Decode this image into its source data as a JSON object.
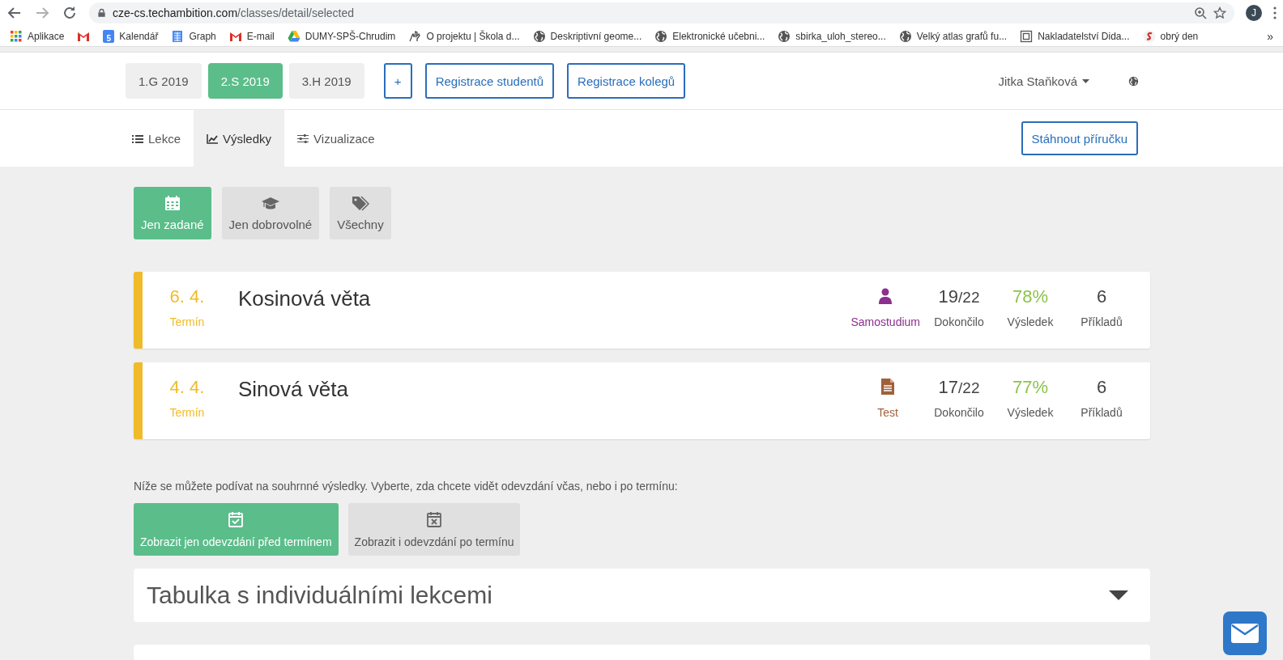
{
  "browser": {
    "url": "cze-cs.techambition.com/classes/detail/selected",
    "avatar": "J",
    "overflow": "»",
    "bookmarks": [
      {
        "kind": "apps",
        "label": "Aplikace"
      },
      {
        "kind": "gmail"
      },
      {
        "kind": "calendar",
        "label": "Kalendář",
        "icon_text": "5"
      },
      {
        "kind": "sheet",
        "label": "Graph"
      },
      {
        "kind": "gmail",
        "label": "E-mail"
      },
      {
        "kind": "drive",
        "label": "DUMY-SPŠ-Chrudim"
      },
      {
        "kind": "hand",
        "label": "O projektu | Škola d..."
      },
      {
        "kind": "globe",
        "label": "Deskriptivní geome..."
      },
      {
        "kind": "globe",
        "label": "Elektronické učebni..."
      },
      {
        "kind": "globe",
        "label": "sbirka_uloh_stereo..."
      },
      {
        "kind": "globe",
        "label": "Velký atlas grafů fu..."
      },
      {
        "kind": "page",
        "label": "Nakladatelství Dida..."
      },
      {
        "kind": "s",
        "label": "obrý den"
      }
    ]
  },
  "header": {
    "classes": [
      {
        "label": "1.G 2019",
        "selected": false
      },
      {
        "label": "2.S 2019",
        "selected": true
      },
      {
        "label": "3.H 2019",
        "selected": false
      }
    ],
    "add_button": "+",
    "buttons": [
      "Registrace studentů",
      "Registrace kolegů"
    ],
    "user": "Jitka Staňková"
  },
  "nav": {
    "tabs": [
      {
        "kind": "list",
        "label": "Lekce",
        "selected": false
      },
      {
        "kind": "chart",
        "label": "Výsledky",
        "selected": true
      },
      {
        "kind": "sliders",
        "label": "Vizualizace",
        "selected": false
      }
    ],
    "download": "Stáhnout příručku"
  },
  "filters": [
    {
      "kind": "calendar",
      "label": "Jen zadané",
      "selected": true
    },
    {
      "kind": "cap",
      "label": "Jen dobrovolné",
      "selected": false
    },
    {
      "kind": "tags",
      "label": "Všechny",
      "selected": false
    }
  ],
  "lessons": [
    {
      "date": "6. 4.",
      "date_label": "Termín",
      "title": "Kosinová věta",
      "type": {
        "kind": "self",
        "label": "Samostudium"
      },
      "done": "19",
      "total": "/22",
      "done_label": "Dokončilo",
      "result": "78%",
      "result_label": "Výsledek",
      "examples": "6",
      "examples_label": "Příkladů"
    },
    {
      "date": "4. 4.",
      "date_label": "Termín",
      "title": "Sinová věta",
      "type": {
        "kind": "test",
        "label": "Test"
      },
      "done": "17",
      "total": "/22",
      "done_label": "Dokončilo",
      "result": "77%",
      "result_label": "Výsledek",
      "examples": "6",
      "examples_label": "Příkladů"
    }
  ],
  "summary_note": "Níže se můžete podívat na souhrnné výsledky. Vyberte, zda chcete vidět odevzdání včas, nebo i po termínu:",
  "submission_filters": [
    {
      "kind": "check",
      "label": "Zobrazit jen odevzdání před termínem",
      "selected": true
    },
    {
      "kind": "cross",
      "label": "Zobrazit i odevzdání po termínu",
      "selected": false
    }
  ],
  "panel": {
    "title": "Tabulka s individuálními lekcemi"
  }
}
